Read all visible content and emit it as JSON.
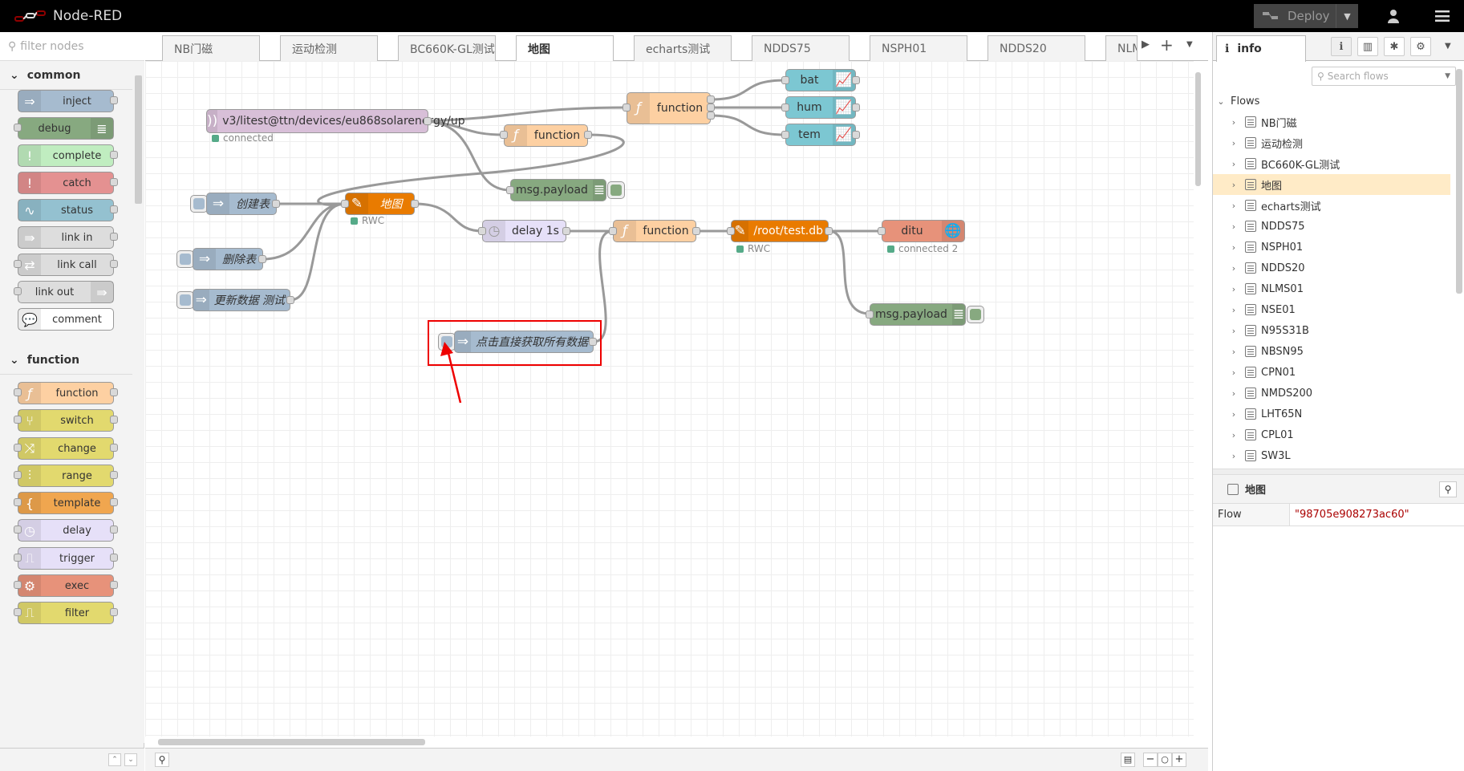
{
  "header": {
    "title": "Node-RED",
    "deploy_label": "Deploy"
  },
  "palette": {
    "filter_placeholder": "filter nodes",
    "categories": [
      {
        "name": "common",
        "nodes": [
          "inject",
          "debug",
          "complete",
          "catch",
          "status",
          "link in",
          "link call",
          "link out",
          "comment"
        ]
      },
      {
        "name": "function",
        "nodes": [
          "function",
          "switch",
          "change",
          "range",
          "template",
          "delay",
          "trigger",
          "exec",
          "filter"
        ]
      }
    ]
  },
  "tabs": [
    "NB门磁",
    "运动检测",
    "BC660K-GL测试",
    "地图",
    "echarts测试",
    "NDDS75",
    "NSPH01",
    "NDDS20",
    "NLMS"
  ],
  "active_tab": "地图",
  "flow": {
    "mqtt_topic": "v3/litest@ttn/devices/eu868solarenergy/up",
    "mqtt_status": "connected",
    "function_top": "function",
    "function_mid": "function",
    "function_row": "function",
    "chart_bat": "bat",
    "chart_hum": "hum",
    "chart_tem": "tem",
    "debug1": "msg.payload",
    "debug2": "msg.payload",
    "inject_create": "创建表",
    "inject_delete": "删除表",
    "inject_update": "更新数据 测试",
    "inject_getall": "点击直接获取所有数据",
    "sqlite_map": "地图",
    "sqlite_map_status": "RWC",
    "delay": "delay 1s",
    "sqlite_db": "/root/test.db",
    "sqlite_db_status": "RWC",
    "ws_out": "ditu",
    "ws_status": "connected 2"
  },
  "sidebar": {
    "tab_label": "info",
    "search_placeholder": "Search flows",
    "tree_root": "Flows",
    "flows": [
      "NB门磁",
      "运动检测",
      "BC660K-GL测试",
      "地图",
      "echarts测试",
      "NDDS75",
      "NSPH01",
      "NDDS20",
      "NLMS01",
      "NSE01",
      "N95S31B",
      "NBSN95",
      "CPN01",
      "NMDS200",
      "LHT65N",
      "CPL01",
      "SW3L"
    ],
    "selected": "地图",
    "info_title": "地图",
    "info_key": "Flow",
    "info_value": "\"98705e908273ac60\""
  },
  "colors": {
    "function": "#fdd0a2",
    "debug": "#87a980",
    "inject": "#a6bbcf",
    "chart": "#7cc7d2",
    "sqlite": "#e97b00",
    "mqtt": "#d8bfd8",
    "delay": "#e6e0f8",
    "ws": "#e7927a",
    "highlight": "#ee0000"
  }
}
